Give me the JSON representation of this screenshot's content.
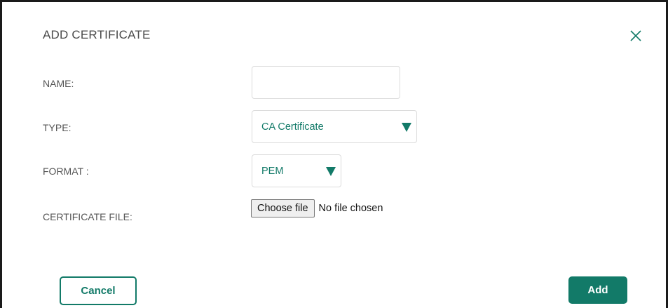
{
  "dialog": {
    "title": "ADD CERTIFICATE",
    "close_icon": "close-icon"
  },
  "form": {
    "name_label": "NAME:",
    "name_value": "",
    "type_label": "TYPE:",
    "type_value": "CA Certificate",
    "format_label": "FORMAT :",
    "format_value": "PEM",
    "certificate_file_label": "CERTIFICATE FILE:",
    "choose_file_label": "Choose file",
    "file_status": "No file chosen",
    "dropdown_icon": "triangle-down-icon"
  },
  "actions": {
    "cancel_label": "Cancel",
    "add_label": "Add"
  },
  "colors": {
    "accent": "#127a68",
    "label_text": "#555555",
    "border": "#dcdcdc"
  }
}
